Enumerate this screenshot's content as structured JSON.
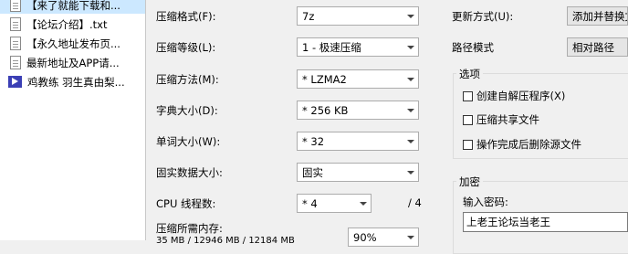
{
  "files": [
    {
      "name": "【来了就能下载和...",
      "icon": "text-file-icon",
      "selected": true
    },
    {
      "name": "【论坛介绍】.txt",
      "icon": "text-file-icon",
      "selected": false
    },
    {
      "name": "【永久地址发布页...",
      "icon": "text-file-icon",
      "selected": false
    },
    {
      "name": "最新地址及APP请...",
      "icon": "text-file-icon",
      "selected": false
    },
    {
      "name": "鸡教练 羽生真由梨...",
      "icon": "video-file-icon",
      "selected": false
    }
  ],
  "settings": {
    "format_label": "压缩格式(F):",
    "format_value": "7z",
    "level_label": "压缩等级(L):",
    "level_value": "1 - 极速压缩",
    "method_label": "压缩方法(M):",
    "method_value": "* LZMA2",
    "dict_label": "字典大小(D):",
    "dict_value": "* 256 KB",
    "word_label": "单词大小(W):",
    "word_value": "* 32",
    "solid_label": "固实数据大小:",
    "solid_value": "固实",
    "threads_label": "CPU 线程数:",
    "threads_value": "* 4",
    "threads_max": "/ 4",
    "memory_label": "压缩所需内存:",
    "memory_percent": "90%",
    "memory_partial": "35 MB / 12946 MB / 12184 MB"
  },
  "right": {
    "update_label": "更新方式(U):",
    "update_value": "添加并替换文",
    "path_label": "路径模式",
    "path_value": "相对路径",
    "options_title": "选项",
    "options": [
      "创建自解压程序(X)",
      "压缩共享文件",
      "操作完成后删除源文件"
    ],
    "encrypt_title": "加密",
    "password_label": "输入密码:",
    "password_value": "上老王论坛当老王"
  }
}
